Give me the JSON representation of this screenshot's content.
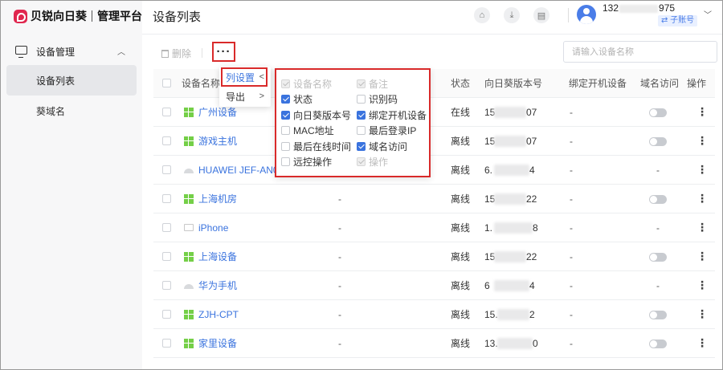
{
  "app": {
    "brand": "贝锐向日葵",
    "subtitle": "管理平台"
  },
  "sidebar": {
    "group": {
      "label": "设备管理",
      "chevron": "︿"
    },
    "items": [
      {
        "label": "设备列表",
        "active": true
      },
      {
        "label": "葵域名",
        "active": false
      }
    ]
  },
  "header": {
    "title": "设备列表",
    "icons": [
      "home-icon",
      "download-icon",
      "document-icon"
    ],
    "user": {
      "name_prefix": "132",
      "name_suffix": "975",
      "badge": "⇄ 子账号"
    }
  },
  "toolbar": {
    "delete_label": "删除",
    "more_label": "···",
    "search_placeholder": "请输入设备名称"
  },
  "column_menu": {
    "items": [
      {
        "label": "列设置",
        "arrow": "<",
        "active": true
      },
      {
        "label": "导出",
        "arrow": ">",
        "active": false
      }
    ]
  },
  "column_settings": [
    {
      "label": "设备名称",
      "state": "disabled"
    },
    {
      "label": "备注",
      "state": "disabled"
    },
    {
      "label": "状态",
      "state": "checked"
    },
    {
      "label": "识别码",
      "state": "unchecked"
    },
    {
      "label": "向日葵版本号",
      "state": "checked"
    },
    {
      "label": "绑定开机设备",
      "state": "checked"
    },
    {
      "label": "MAC地址",
      "state": "unchecked"
    },
    {
      "label": "最后登录IP",
      "state": "unchecked"
    },
    {
      "label": "最后在线时间",
      "state": "unchecked"
    },
    {
      "label": "域名访问",
      "state": "checked"
    },
    {
      "label": "远控操作",
      "state": "unchecked"
    },
    {
      "label": "操作",
      "state": "disabled"
    }
  ],
  "table": {
    "headers": {
      "name": "设备名称",
      "status": "状态",
      "version": "向日葵版本号",
      "bind": "绑定开机设备",
      "domain": "域名访问",
      "action": "操作"
    },
    "rows": [
      {
        "icon": "windows-icon",
        "name": "广州设备",
        "remark": "",
        "status": "在线",
        "version_start": "15",
        "version_end": "07",
        "bind": "-",
        "domain": "toggle"
      },
      {
        "icon": "windows-icon",
        "name": "游戏主机",
        "remark": "",
        "status": "离线",
        "version_start": "15",
        "version_end": "07",
        "bind": "-",
        "domain": "toggle"
      },
      {
        "icon": "android-icon",
        "name": "HUAWEI JEF-AN00",
        "remark": "",
        "status": "离线",
        "version_start": "6.",
        "version_end": "4",
        "bind": "-",
        "domain": "-"
      },
      {
        "icon": "windows-icon",
        "name": "上海机房",
        "remark": "-",
        "status": "离线",
        "version_start": "15",
        "version_end": "22",
        "bind": "-",
        "domain": "toggle"
      },
      {
        "icon": "apple-icon",
        "name": "iPhone",
        "remark": "-",
        "status": "离线",
        "version_start": "1.",
        "version_end": "8",
        "bind": "-",
        "domain": "-"
      },
      {
        "icon": "windows-icon",
        "name": "上海设备",
        "remark": "-",
        "status": "离线",
        "version_start": "15",
        "version_end": "22",
        "bind": "-",
        "domain": "toggle"
      },
      {
        "icon": "android-icon",
        "name": "华为手机",
        "remark": "-",
        "status": "离线",
        "version_start": "6",
        "version_end": "4",
        "bind": "-",
        "domain": "-"
      },
      {
        "icon": "windows-icon",
        "name": "ZJH-CPT",
        "remark": "-",
        "status": "离线",
        "version_start": "15.",
        "version_end": "2",
        "bind": "-",
        "domain": "toggle"
      },
      {
        "icon": "windows-icon",
        "name": "家里设备",
        "remark": "-",
        "status": "离线",
        "version_start": "13.",
        "version_end": "0",
        "bind": "-",
        "domain": "toggle"
      }
    ]
  },
  "colors": {
    "accent": "#3a73de",
    "brand": "#e0264e",
    "highlight_box": "#d92a2a"
  }
}
